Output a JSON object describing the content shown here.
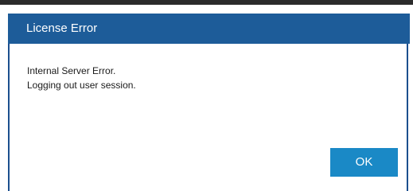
{
  "dialog": {
    "title": "License Error",
    "message_lines": [
      "Internal Server Error.",
      "Logging out user session."
    ],
    "ok_label": "OK"
  },
  "colors": {
    "title_bar": "#1d5c99",
    "ok_button": "#1a89c6",
    "border": "#1c4f8e"
  }
}
